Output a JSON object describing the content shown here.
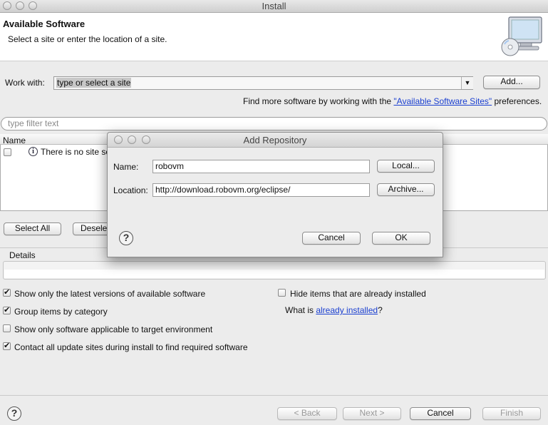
{
  "window": {
    "title": "Install"
  },
  "header": {
    "title": "Available Software",
    "subtitle": "Select a site or enter the location of a site."
  },
  "work_with": {
    "label": "Work with:",
    "value": "type or select a site",
    "add_button": "Add...",
    "hint_prefix": "Find more software by working with the ",
    "hint_link": "\"Available Software Sites\"",
    "hint_suffix": " preferences."
  },
  "filter": {
    "placeholder": "type filter text"
  },
  "table": {
    "column_name": "Name",
    "row_text": "There is no site se",
    "row_icon": "info-icon"
  },
  "selection_buttons": {
    "select_all": "Select All",
    "deselect_all": "Desele"
  },
  "details": {
    "label": "Details"
  },
  "options": {
    "latest_versions": {
      "label": "Show only the latest versions of available software",
      "checked": true
    },
    "group_by_category": {
      "label": "Group items by category",
      "checked": true
    },
    "target_env": {
      "label": "Show only software applicable to target environment",
      "checked": false
    },
    "contact_sites": {
      "label": "Contact all update sites during install to find required software",
      "checked": true
    },
    "hide_installed": {
      "label": "Hide items that are already installed",
      "checked": false
    },
    "what_is_prefix": "What is ",
    "what_is_link": "already installed",
    "what_is_suffix": "?"
  },
  "footer": {
    "back": "< Back",
    "next": "Next >",
    "cancel": "Cancel",
    "finish": "Finish"
  },
  "dialog": {
    "title": "Add Repository",
    "name_label": "Name:",
    "name_value": "robovm",
    "local_button": "Local...",
    "location_label": "Location:",
    "location_value": "http://download.robovm.org/eclipse/",
    "archive_button": "Archive...",
    "cancel": "Cancel",
    "ok": "OK"
  },
  "icons": {
    "help": "help-icon",
    "banner": "install-monitor-icon",
    "dropdown": "chevron-down-icon"
  }
}
